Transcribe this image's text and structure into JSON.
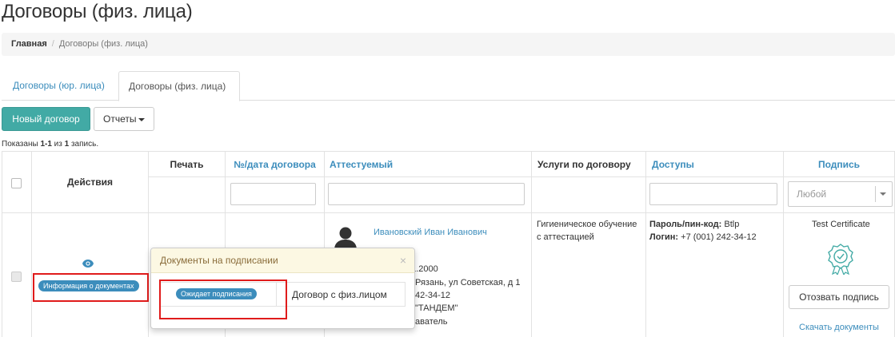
{
  "page": {
    "title": "Договоры (физ. лица)"
  },
  "breadcrumb": {
    "home": "Главная",
    "separator": "/",
    "current": "Договоры (физ. лица)"
  },
  "tabs": [
    {
      "label": "Договоры (юр. лица)",
      "active": false
    },
    {
      "label": "Договоры (физ. лица)",
      "active": true
    }
  ],
  "toolbar": {
    "new_label": "Новый договор",
    "reports_label": "Отчеты"
  },
  "summary": {
    "prefix": "Показаны ",
    "range": "1-1",
    "middle": " из ",
    "total": "1",
    "suffix": " запись."
  },
  "table": {
    "headers": {
      "actions": "Действия",
      "print": "Печать",
      "number": "№/дата договора",
      "person": "Аттестуемый",
      "services": "Услуги по договору",
      "access": "Доступы",
      "sign": "Подпись"
    },
    "sign_filter": {
      "selected": "Любой"
    },
    "row": {
      "docs_badge": "Информация о документах",
      "person_name": "Ивановский Иван Иванович",
      "person_lines": [
        "01.2000",
        "Рязань, ул Советская, д 1",
        "42-34-12",
        "\"ТАНДЕМ\"",
        "аватель"
      ],
      "services_text": "Гигиеническое обучение с аттестацией",
      "access_password_label": "Пароль/пин-код:",
      "access_password_value": " Btlp",
      "access_login_label": "Логин:",
      "access_login_value": " +7 (001) 242-34-12",
      "cert_label": "Test Certificate",
      "revoke_label": "Отозвать подпись",
      "download_label": "Скачать документы"
    }
  },
  "popover": {
    "title": "Документы на подписании",
    "close": "×",
    "status_badge": "Ожидает подписания",
    "doc_name": "Договор с физ.лицом"
  },
  "colors": {
    "primary_teal": "#42aaa5",
    "link_blue": "#3c8dbc",
    "highlight_red": "#e01b1b",
    "popover_header": "#fcf8e3"
  }
}
